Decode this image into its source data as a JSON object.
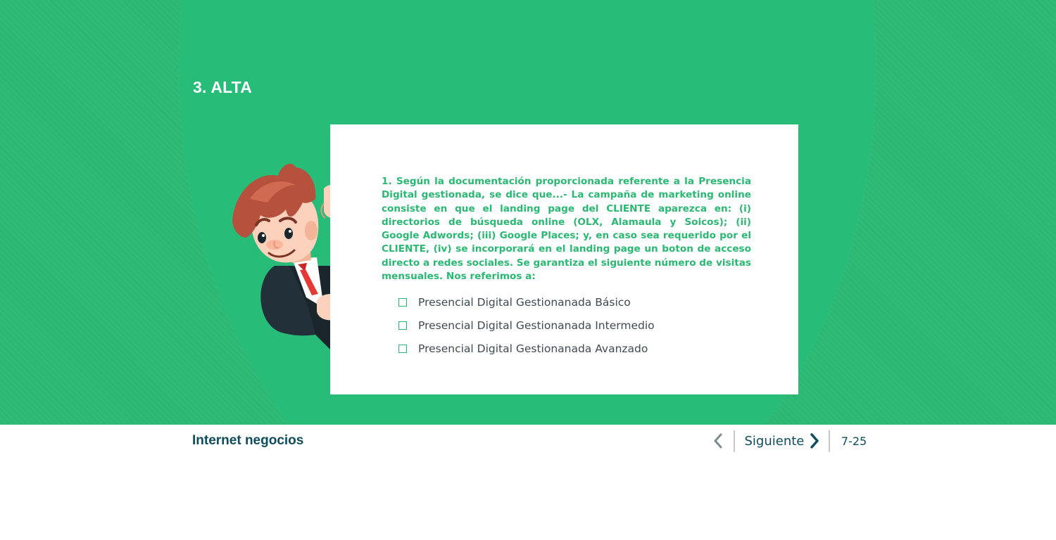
{
  "section": {
    "title": "3. ALTA"
  },
  "question": {
    "text": "1. Según la documentación proporcionada referente a la Presencia Digital gestionada, se dice que...- La campaña de marketing online consiste en que el landing page del CLIENTE aparezca en:  (i) directorios de búsqueda online (OLX, Alamaula y Soicos); (ii) Google Adwords; (iii) Google Places; y, en caso sea requerido por el CLIENTE, (iv) se incorporará en el landing page un boton de acceso directo a redes sociales. Se garantiza el siguiente número de visitas mensuales. Nos referimos a:",
    "options": [
      {
        "label": "Presencial Digital Gestionanada Básico",
        "checked": false
      },
      {
        "label": "Presencial Digital Gestionanada Intermedio",
        "checked": false
      },
      {
        "label": "Presencial Digital Gestionanada Avanzado",
        "checked": false
      }
    ]
  },
  "footer": {
    "brand": "Internet negocios",
    "next_label": "Siguiente",
    "page_indicator": "7-25",
    "prev_icon": "chevron-left-icon",
    "next_icon": "chevron-right-icon"
  },
  "colors": {
    "background_green": "#2ab873",
    "text_green": "#2ab873",
    "footer_text": "#0f4c5c",
    "option_text": "#3f4a52",
    "card": "#ffffff"
  }
}
